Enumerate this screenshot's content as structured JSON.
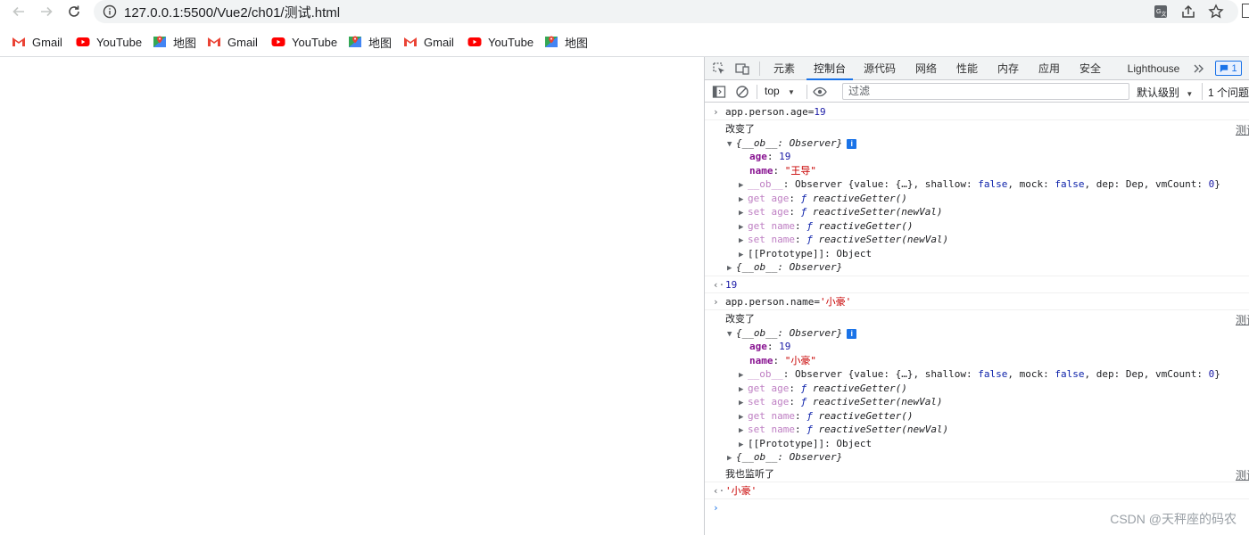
{
  "browser": {
    "url": "127.0.0.1:5500/Vue2/ch01/测试.html",
    "bookmarks": [
      {
        "label": "Gmail",
        "icon": "gmail-icon"
      },
      {
        "label": "YouTube",
        "icon": "youtube-icon"
      },
      {
        "label": "地图",
        "icon": "maps-icon"
      },
      {
        "label": "Gmail",
        "icon": "gmail-icon"
      },
      {
        "label": "YouTube",
        "icon": "youtube-icon"
      },
      {
        "label": "地图",
        "icon": "maps-icon"
      },
      {
        "label": "Gmail",
        "icon": "gmail-icon"
      },
      {
        "label": "YouTube",
        "icon": "youtube-icon"
      },
      {
        "label": "地图",
        "icon": "maps-icon"
      }
    ]
  },
  "devtools": {
    "tabs": [
      "元素",
      "控制台",
      "源代码",
      "网络",
      "性能",
      "内存",
      "应用",
      "安全",
      "Lighthouse"
    ],
    "active_tab": "控制台",
    "issues_badge": "1",
    "context": "top",
    "filter_placeholder": "过滤",
    "levels": "默认级别",
    "issues_count": "1 个问题"
  },
  "console": {
    "source_link": "测试",
    "cmd1": "app.person.age=",
    "cmd1_val": "19",
    "msg_changed": "改变了",
    "obj_open": "{__ob__: Observer}",
    "age_key": "age",
    "age_val_1": "19",
    "name_key": "name",
    "name_val_1": "\"王导\"",
    "ob_key": "__ob__",
    "ob_detail": ": Observer {value: {…}, shallow: ",
    "ob_false": "false",
    "ob_mock": ", mock: ",
    "ob_dep": ", dep: Dep, vmCount: ",
    "ob_zero": "0",
    "ob_close": "}",
    "get_age": "get age",
    "set_age": "set age",
    "get_name": "get name",
    "set_name": "set name",
    "fn_prefix": "ƒ",
    "reactive_getter": "reactiveGetter()",
    "reactive_setter": "reactiveSetter(newVal)",
    "proto": "[[Prototype]]: Object",
    "result1": "19",
    "cmd2": "app.person.name=",
    "cmd2_val": "'小豪'",
    "age_val_2": "19",
    "name_val_2": "\"小豪\"",
    "msg_watch": "我也监听了",
    "result2": "'小豪'"
  },
  "watermark": "CSDN @天秤座的码农"
}
